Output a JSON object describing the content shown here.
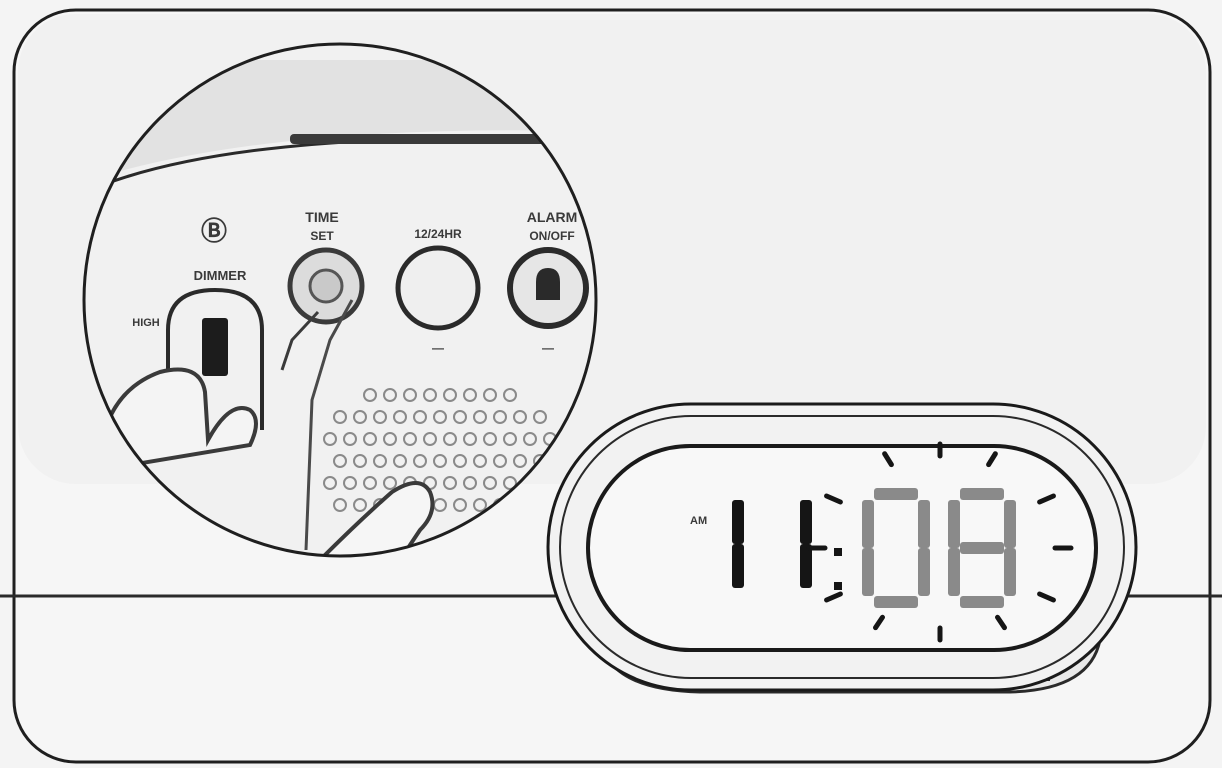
{
  "controls": {
    "dimmer_symbol": "Ⓑ",
    "dimmer_label": "DIMMER",
    "high_label": "HIGH",
    "time_set_line1": "TIME",
    "time_set_line2": "SET",
    "hour_format_label": "12/24HR",
    "hour_format_sub": "—",
    "alarm_line1": "ALARM",
    "alarm_line2": "ON/OFF",
    "alarm_sub": "—"
  },
  "display": {
    "am_label": "AM",
    "hour": "11",
    "minute": "08",
    "minute_state": "flashing"
  },
  "colors": {
    "background": "#f4f4f4",
    "outline": "#1a1a1a",
    "segment_on": "#151515",
    "segment_flashing": "#8a8a8a"
  }
}
